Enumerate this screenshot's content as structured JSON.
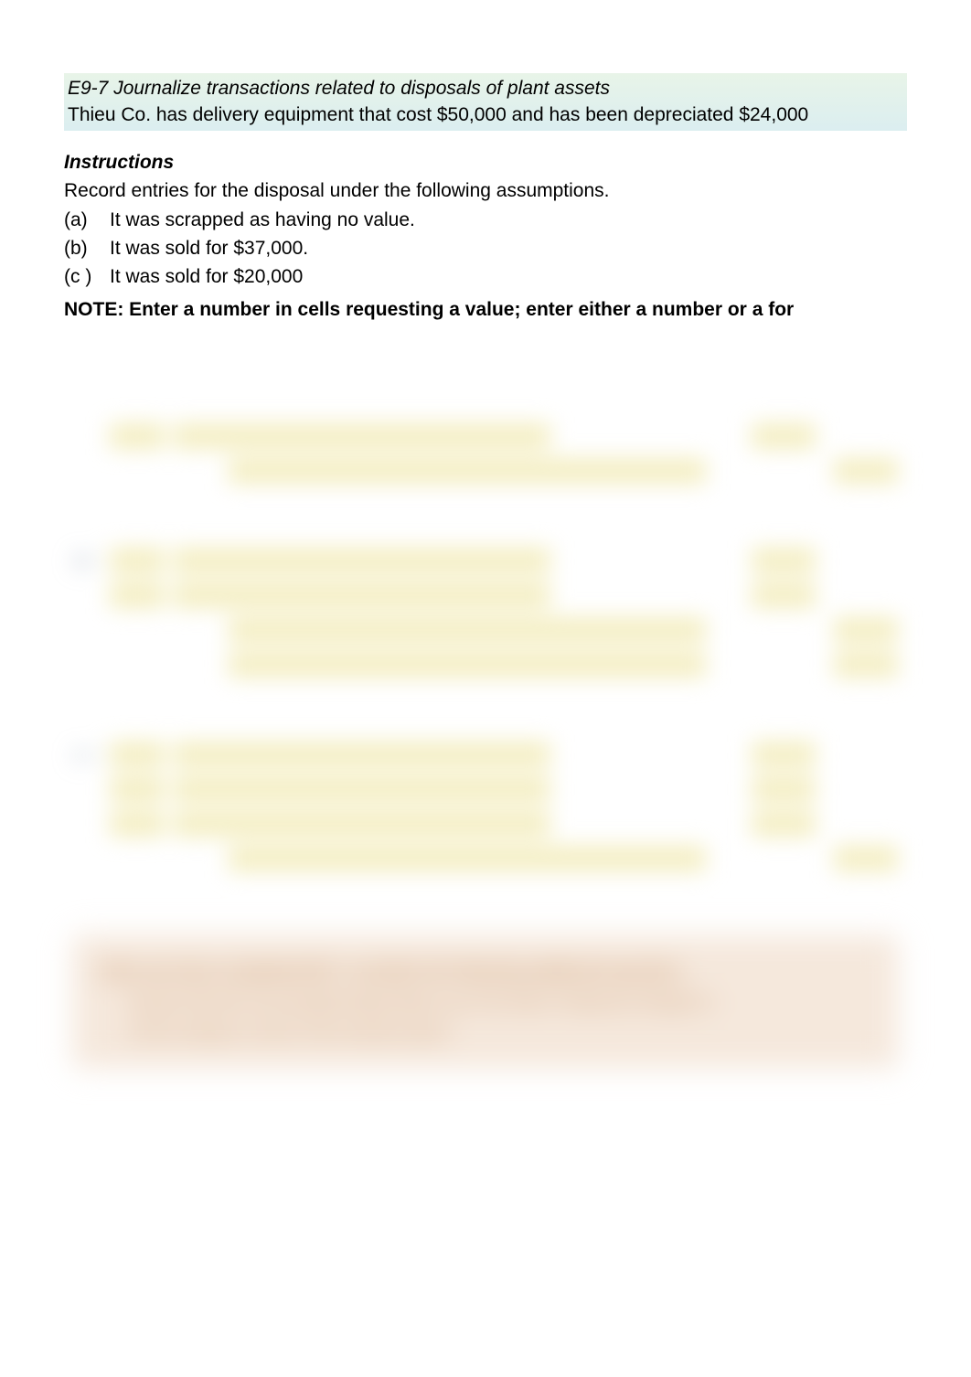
{
  "header": {
    "title": "E9-7  Journalize transactions related to disposals of plant assets",
    "body": "Thieu Co. has delivery equipment that cost $50,000 and has been depreciated $24,000"
  },
  "instructions": {
    "heading": "Instructions",
    "lead": "Record entries for the disposal under the following assumptions.",
    "options": [
      {
        "label": "(a)",
        "text": "It was scrapped as having no value."
      },
      {
        "label": "(b)",
        "text": "It was sold for $37,000."
      },
      {
        "label": "(c )",
        "text": "It was sold for $20,000"
      }
    ],
    "note": "NOTE:  Enter a number in cells requesting a value; enter either a number or a for"
  },
  "entries": {
    "a": {
      "rows": [
        {
          "acct": "",
          "debit": "",
          "credit": ""
        },
        {
          "acct": "",
          "debit": "",
          "credit": ""
        }
      ]
    },
    "b": {
      "label": "(b)",
      "rows": [
        {
          "acct": "",
          "debit": "",
          "credit": ""
        },
        {
          "acct": "",
          "debit": "",
          "credit": ""
        },
        {
          "acct": "",
          "debit": "",
          "credit": ""
        },
        {
          "acct": "",
          "debit": "",
          "credit": ""
        }
      ]
    },
    "c": {
      "label": "(c )",
      "rows": [
        {
          "acct": "",
          "debit": "",
          "credit": ""
        },
        {
          "acct": "",
          "debit": "",
          "credit": ""
        },
        {
          "acct": "",
          "debit": "",
          "credit": ""
        },
        {
          "acct": "",
          "debit": "",
          "credit": ""
        }
      ]
    }
  },
  "footer": {
    "line1": "After you have completed E9-7, consider the following additional question.",
    "line2": "Assume that the accumulated depreciation up to the date of disposal changed to",
    "line3": "of this change on each of the answers given."
  }
}
